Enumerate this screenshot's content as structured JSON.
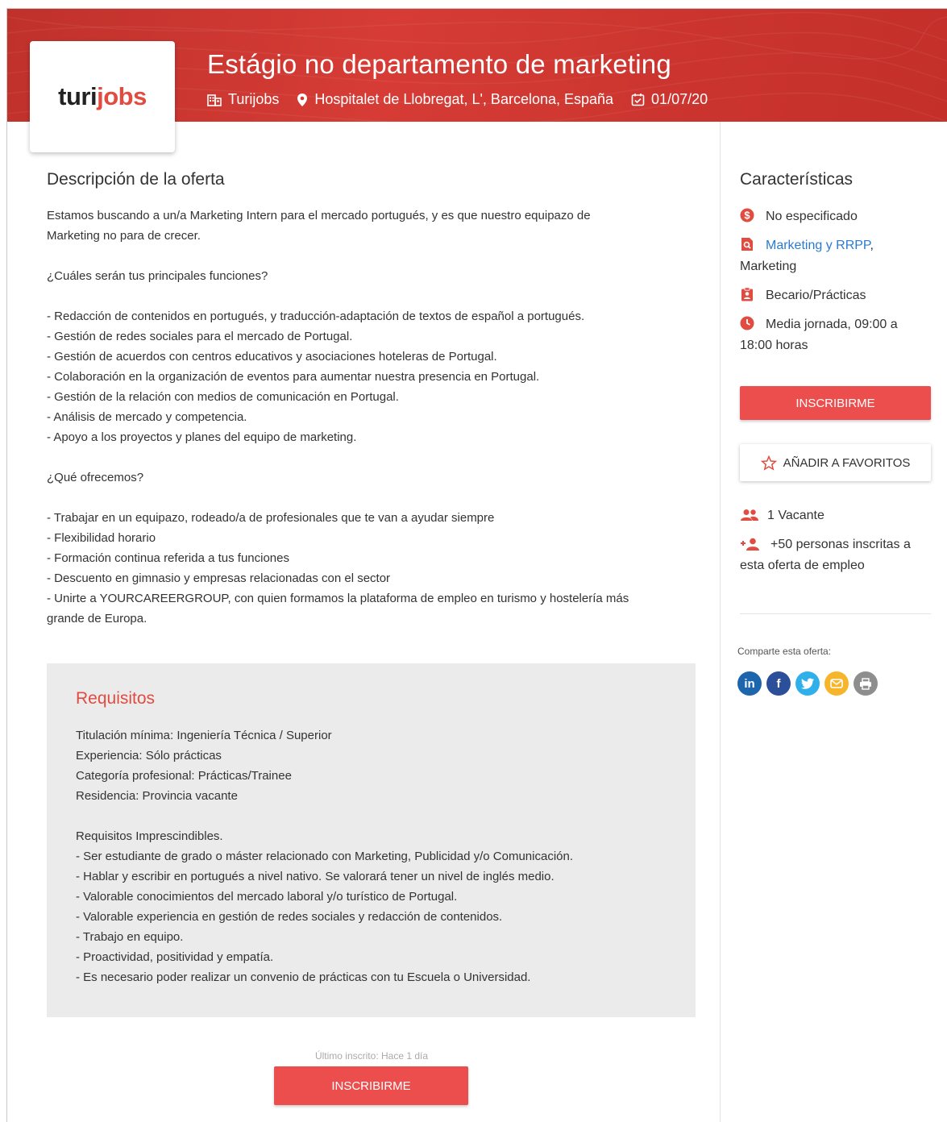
{
  "header": {
    "logo_part1": "turi",
    "logo_part2": "jobs",
    "title": "Estágio no departamento de marketing",
    "company": "Turijobs",
    "location": "Hospitalet de Llobregat, L', Barcelona, España",
    "date": "01/07/20"
  },
  "description": {
    "heading": "Descripción de la oferta",
    "lines": [
      "Estamos buscando a un/a Marketing Intern para el mercado portugués, y es que nuestro equipazo de",
      "Marketing no para de crecer.",
      "",
      "¿Cuáles serán tus principales funciones?",
      "",
      "- Redacción de contenidos en portugués, y traducción-adaptación de textos de español a portugués.",
      "- Gestión de redes sociales para el mercado de Portugal.",
      "- Gestión de acuerdos con centros educativos y asociaciones hoteleras de Portugal.",
      "- Colaboración en la organización de eventos para aumentar nuestra presencia en Portugal.",
      "- Gestión de la relación con medios de comunicación en Portugal.",
      "- Análisis de mercado y competencia.",
      "- Apoyo a los proyectos y planes del equipo de marketing.",
      "",
      "¿Qué ofrecemos?",
      "",
      "- Trabajar en un equipazo, rodeado/a de profesionales que te van a ayudar siempre",
      "- Flexibilidad horario",
      "- Formación continua referida a tus funciones",
      "- Descuento en gimnasio y empresas relacionadas con el sector",
      "- Unirte a YOURCAREERGROUP, con quien formamos la plataforma de empleo en turismo y hostelería más",
      "grande de Europa."
    ]
  },
  "requirements": {
    "heading": "Requisitos",
    "lines": [
      "Titulación mínima: Ingeniería Técnica / Superior",
      "Experiencia: Sólo prácticas",
      "Categoría profesional: Prácticas/Trainee",
      "Residencia: Provincia vacante",
      "",
      "Requisitos Imprescindibles.",
      "- Ser estudiante de grado o máster relacionado con Marketing, Publicidad y/o Comunicación.",
      "- Hablar y escribir en portugués a nivel nativo. Se valorará tener un nivel de inglés medio.",
      "- Valorable conocimientos del mercado laboral y/o turístico de Portugal.",
      "- Valorable experiencia en gestión de redes sociales y redacción de contenidos.",
      "- Trabajo en equipo.",
      "- Proactividad, positividad y empatía.",
      "- Es necesario poder realizar un convenio de prácticas con tu Escuela o Universidad."
    ]
  },
  "footer": {
    "last_applicant": "Último inscrito: Hace 1 día",
    "apply_label": "INSCRIBIRME"
  },
  "sidebar": {
    "heading": "Características",
    "salary": "No especificado",
    "category_link": "Marketing y RRPP",
    "category_rest": ", Marketing",
    "contract": "Becario/Prácticas",
    "schedule": "Media jornada, 09:00 a 18:00 horas",
    "apply_label": "INSCRIBIRME",
    "favorites_label": "AÑADIR A FAVORITOS",
    "vacancies": "1 Vacante",
    "applicants": "+50 personas inscritas a esta oferta de empleo",
    "share_label": "Comparte esta oferta:"
  },
  "share": {
    "linkedin": "in",
    "facebook": "f"
  },
  "colors": {
    "brand_red": "#e14b40",
    "button_red": "#ec4d4d",
    "link_blue": "#2a7bd0",
    "linkedin": "#1d66ae",
    "facebook": "#2c4f99",
    "twitter": "#2fb0ea",
    "email": "#f7b52b",
    "print": "#8e8e8e"
  }
}
